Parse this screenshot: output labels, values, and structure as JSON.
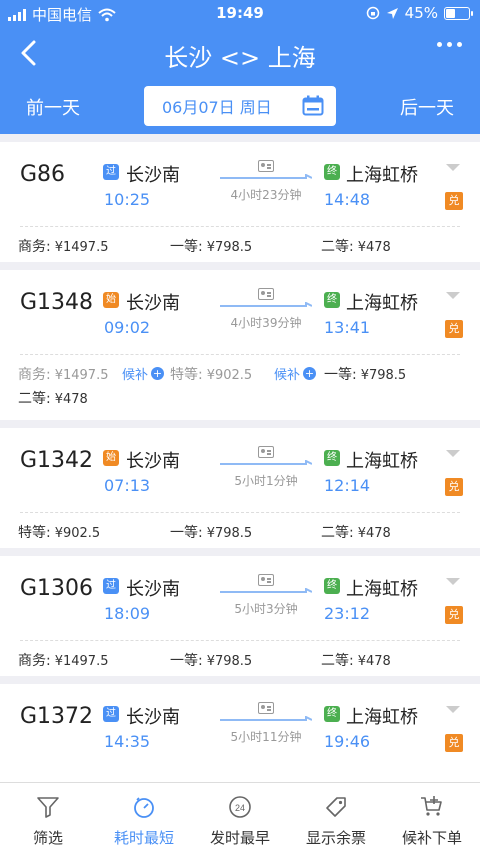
{
  "status": {
    "carrier": "中国电信",
    "time": "19:49",
    "battery": "45%",
    "battery_level": 0.45
  },
  "nav": {
    "title": "长沙 <> 上海",
    "prev_day": "前一天",
    "next_day": "后一天",
    "date": "06月07日 周日"
  },
  "trains": [
    {
      "no": "G86",
      "badge_from": "过",
      "from": "长沙南",
      "dep": "10:25",
      "badge_to": "终",
      "to": "上海虹桥",
      "arr": "14:48",
      "duration": "4小时23分钟",
      "exchange": "兑",
      "seats": [
        {
          "label": "商务:",
          "price": "¥1497.5"
        },
        {
          "label": "一等:",
          "price": "¥798.5"
        },
        {
          "label": "二等:",
          "price": "¥478"
        }
      ]
    },
    {
      "no": "G1348",
      "badge_from": "始",
      "from": "长沙南",
      "dep": "09:02",
      "badge_to": "终",
      "to": "上海虹桥",
      "arr": "13:41",
      "duration": "4小时39分钟",
      "exchange": "兑",
      "seats": [
        {
          "label": "商务:",
          "price": "¥1497.5",
          "houbu": "候补"
        },
        {
          "label": "特等:",
          "price": "¥902.5",
          "houbu": "候补"
        },
        {
          "label": "一等:",
          "price": "¥798.5"
        },
        {
          "label": "二等:",
          "price": "¥478"
        }
      ]
    },
    {
      "no": "G1342",
      "badge_from": "始",
      "from": "长沙南",
      "dep": "07:13",
      "badge_to": "终",
      "to": "上海虹桥",
      "arr": "12:14",
      "duration": "5小时1分钟",
      "exchange": "兑",
      "seats": [
        {
          "label": "特等:",
          "price": "¥902.5"
        },
        {
          "label": "一等:",
          "price": "¥798.5"
        },
        {
          "label": "二等:",
          "price": "¥478"
        }
      ]
    },
    {
      "no": "G1306",
      "badge_from": "过",
      "from": "长沙南",
      "dep": "18:09",
      "badge_to": "终",
      "to": "上海虹桥",
      "arr": "23:12",
      "duration": "5小时3分钟",
      "exchange": "兑",
      "seats": [
        {
          "label": "商务:",
          "price": "¥1497.5"
        },
        {
          "label": "一等:",
          "price": "¥798.5"
        },
        {
          "label": "二等:",
          "price": "¥478"
        }
      ]
    },
    {
      "no": "G1372",
      "badge_from": "过",
      "from": "长沙南",
      "dep": "14:35",
      "badge_to": "终",
      "to": "上海虹桥",
      "arr": "19:46",
      "duration": "5小时11分钟",
      "exchange": "兑",
      "seats": []
    }
  ],
  "tabs": [
    {
      "label": "筛选",
      "icon": "filter-icon"
    },
    {
      "label": "耗时最短",
      "icon": "timer-icon",
      "active": true
    },
    {
      "label": "发时最早",
      "icon": "clock-24-icon",
      "icon_text": "24"
    },
    {
      "label": "显示余票",
      "icon": "ticket-tag-icon"
    },
    {
      "label": "候补下单",
      "icon": "cart-plus-icon"
    }
  ],
  "colors": {
    "primary": "#4a90f5",
    "orange": "#f08a24",
    "green": "#4caf50"
  }
}
